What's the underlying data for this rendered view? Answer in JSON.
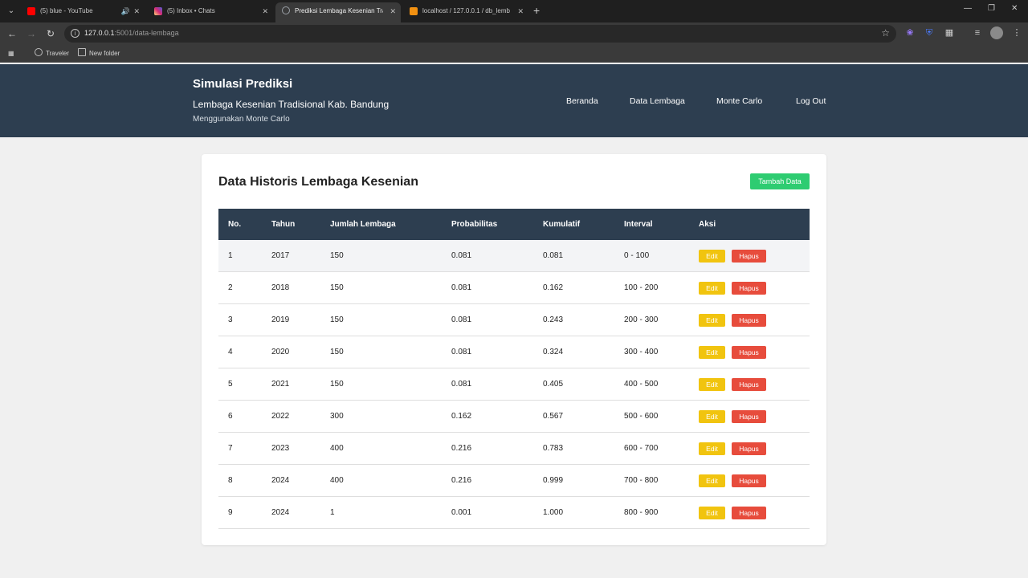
{
  "browser": {
    "tabs": [
      {
        "title": "(5) blue - YouTube",
        "favicon_color": "#ff0000"
      },
      {
        "title": "(5) Inbox • Chats",
        "favicon_color": "#d62976"
      },
      {
        "title": "Prediksi Lembaga Kesenian Tra",
        "favicon_color": "#9aa0a6"
      },
      {
        "title": "localhost / 127.0.0.1 / db_lemb",
        "favicon_color": "#f29111"
      }
    ],
    "url_host": "127.0.0.1",
    "url_path": ":5001/data-lembaga",
    "bookmarks": [
      "Traveler",
      "New folder"
    ]
  },
  "header": {
    "brand": "Simulasi Prediksi",
    "subtitle": "Lembaga Kesenian Tradisional Kab. Bandung",
    "subtitle2": "Menggunakan Monte Carlo",
    "nav": [
      "Beranda",
      "Data Lembaga",
      "Monte Carlo",
      "Log Out"
    ]
  },
  "card": {
    "title": "Data Historis Lembaga Kesenian",
    "add_button": "Tambah Data"
  },
  "table": {
    "columns": [
      "No.",
      "Tahun",
      "Jumlah Lembaga",
      "Probabilitas",
      "Kumulatif",
      "Interval",
      "Aksi"
    ],
    "edit_label": "Edit",
    "delete_label": "Hapus",
    "rows": [
      [
        "1",
        "2017",
        "150",
        "0.081",
        "0.081",
        "0 - 100"
      ],
      [
        "2",
        "2018",
        "150",
        "0.081",
        "0.162",
        "100 - 200"
      ],
      [
        "3",
        "2019",
        "150",
        "0.081",
        "0.243",
        "200 - 300"
      ],
      [
        "4",
        "2020",
        "150",
        "0.081",
        "0.324",
        "300 - 400"
      ],
      [
        "5",
        "2021",
        "150",
        "0.081",
        "0.405",
        "400 - 500"
      ],
      [
        "6",
        "2022",
        "300",
        "0.162",
        "0.567",
        "500 - 600"
      ],
      [
        "7",
        "2023",
        "400",
        "0.216",
        "0.783",
        "600 - 700"
      ],
      [
        "8",
        "2024",
        "400",
        "0.216",
        "0.999",
        "700 - 800"
      ],
      [
        "9",
        "2024",
        "1",
        "0.001",
        "1.000",
        "800 - 900"
      ]
    ]
  }
}
